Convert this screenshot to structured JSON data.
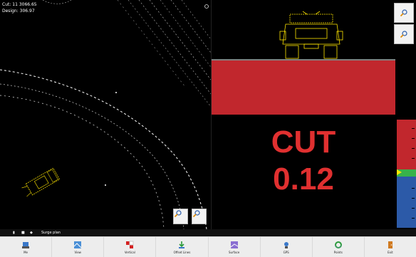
{
  "readout": {
    "line1": "Cut: 11 3066.65",
    "line2": "Design: 306.97"
  },
  "cut_panel": {
    "label": "CUT",
    "value": "0.12"
  },
  "cut_scale": {
    "level_fraction": 0.49,
    "colors": {
      "cut": "#c1272d",
      "on_grade": "#37b34a",
      "fill": "#2c5aa8",
      "pointer": "#ffe600"
    }
  },
  "zoom_buttons": {
    "icon": "magnifier-icon"
  },
  "statusbar": {
    "text": "Surge plan"
  },
  "toolbar": {
    "items": [
      {
        "label": "Me",
        "icon": "machine-icon"
      },
      {
        "label": "View",
        "icon": "view-icon"
      },
      {
        "label": "Vertical",
        "icon": "vertical-icon"
      },
      {
        "label": "Offset Lines",
        "icon": "offset-lines-icon"
      },
      {
        "label": "Surface",
        "icon": "surface-icon"
      },
      {
        "label": "GPS",
        "icon": "gps-icon"
      },
      {
        "label": "Points",
        "icon": "points-icon"
      },
      {
        "label": "Exit",
        "icon": "exit-icon"
      }
    ]
  }
}
